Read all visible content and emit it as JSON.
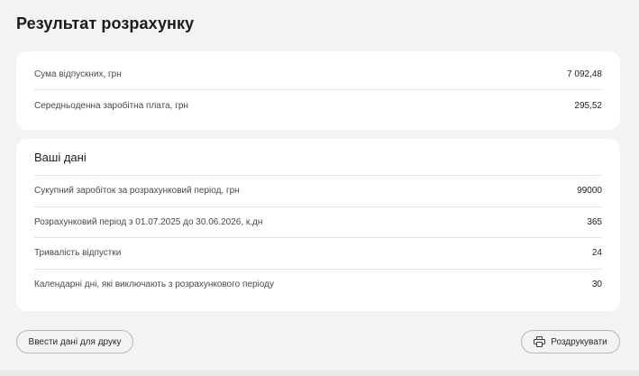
{
  "page": {
    "title": "Результат розрахунку"
  },
  "summary": {
    "rows": [
      {
        "label": "Сума відпускних, грн",
        "value": "7 092,48"
      },
      {
        "label": "Середньоденна заробітна плата, грн",
        "value": "295,52"
      }
    ]
  },
  "details": {
    "title": "Ваші дані",
    "rows": [
      {
        "label": "Сукупний заробіток за розрахунковий період, грн",
        "value": "99000"
      },
      {
        "label": "Розрахунковий період з 01.07.2025 до 30.06.2026, к.дн",
        "value": "365"
      },
      {
        "label": "Тривалість відпустки",
        "value": "24"
      },
      {
        "label": "Календарні дні, які виключають з розрахункового періоду",
        "value": "30"
      }
    ]
  },
  "actions": {
    "enter_print_data": "Ввести дані для друку",
    "print": "Роздрукувати",
    "print_icon": "printer-icon"
  }
}
